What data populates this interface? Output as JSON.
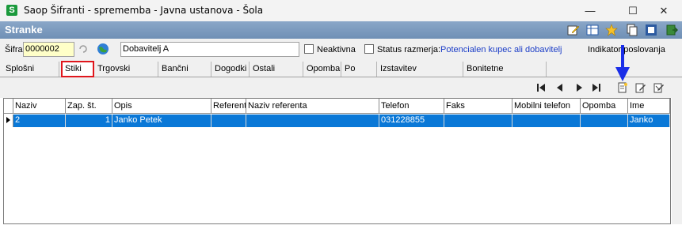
{
  "window": {
    "title": "Saop Šifranti - sprememba - Javna ustanova - Šola",
    "app_icon_letter": "S",
    "min_glyph": "—",
    "max_glyph": "☐",
    "close_glyph": "✕"
  },
  "header": {
    "title": "Stranke",
    "toolbar_icons": [
      "edit-icon",
      "table-icon",
      "star-icon",
      "copy-icon",
      "export-icon",
      "exit-icon"
    ]
  },
  "form": {
    "sifra_label": "Šifra",
    "sifra_value": "0000002",
    "name_value": "Dobavitelj A",
    "neaktivna_label": "Neaktivna",
    "status_label": "Status razmerja:",
    "status_value": "Potencialen kupec ali dobavitelj",
    "indicator_label": "Indikator poslovanja"
  },
  "tabs": [
    {
      "label": "Splošni podatki"
    },
    {
      "label": "Stiki"
    },
    {
      "label": "Trgovski podatki"
    },
    {
      "label": "Bančni računi"
    },
    {
      "label": "Dogodki"
    },
    {
      "label": "Ostali podatki"
    },
    {
      "label": "Opomba"
    },
    {
      "label": "Po meri"
    },
    {
      "label": "Izstavitev dokumentov"
    },
    {
      "label": "Bonitetne informacije"
    }
  ],
  "active_tab": "Stiki",
  "grid": {
    "columns": [
      "Naziv",
      "Zap. št.",
      "Opis",
      "Referent",
      "Naziv referenta",
      "Telefon",
      "Faks",
      "Mobilni telefon",
      "Opomba",
      "Ime"
    ],
    "rows": [
      {
        "naziv": "2",
        "zap": "1",
        "opis": "Janko Petek",
        "referent": "",
        "naziv_referenta": "",
        "telefon": "031228855",
        "faks": "",
        "mobilni": "",
        "opomba": "",
        "ime": "Janko"
      }
    ]
  },
  "colors": {
    "header_band": "#7a98bd",
    "selected_row": "#0a78d7",
    "highlight_box": "#e0161c",
    "arrow": "#1a2ee8"
  }
}
